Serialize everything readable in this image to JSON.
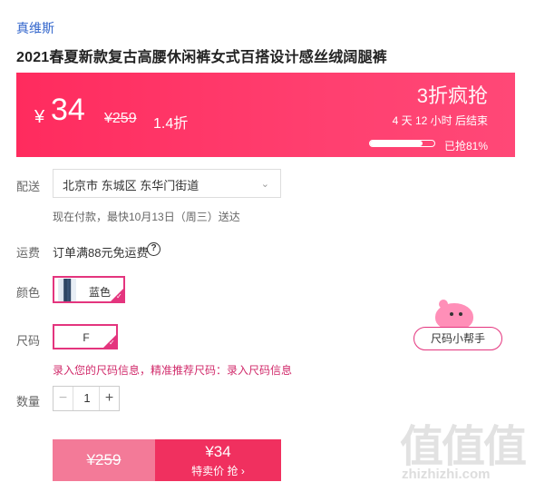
{
  "brand": "真维斯",
  "title": "2021春夏新款复古高腰休闲裤女式百搭设计感丝绒阔腿裤",
  "price_banner": {
    "currency": "¥",
    "price": "34",
    "original_price": "¥259",
    "discount": "1.4折",
    "flash_label": "3折疯抢",
    "countdown": "4 天 12 小时 后结束",
    "sold_label": "已抢81%",
    "sold_fraction": 0.81
  },
  "shipping": {
    "label": "配送",
    "address": "北京市 东城区 东华门街道",
    "note": "现在付款，最快10月13日（周三）送达"
  },
  "fee": {
    "label": "运费",
    "text": "订单满88元免运费",
    "help_icon": "?"
  },
  "color": {
    "label": "颜色",
    "option": "蓝色"
  },
  "size": {
    "label": "尺码",
    "option": "F",
    "tip": "录入您的尺码信息，精准推荐尺码：录入尺码信息",
    "helper_button": "尺码小帮手"
  },
  "quantity": {
    "label": "数量",
    "minus": "−",
    "value": "1",
    "plus": "+"
  },
  "buy": {
    "original": "¥259",
    "price": "¥34",
    "cta": "特卖价 抢 ›"
  },
  "watermark": {
    "glyphs": "值值值",
    "site": "zhizhizhi.com"
  },
  "colors": {
    "accent": "#ff2b5e",
    "link": "#3366cc",
    "select_border": "#e4357e"
  }
}
